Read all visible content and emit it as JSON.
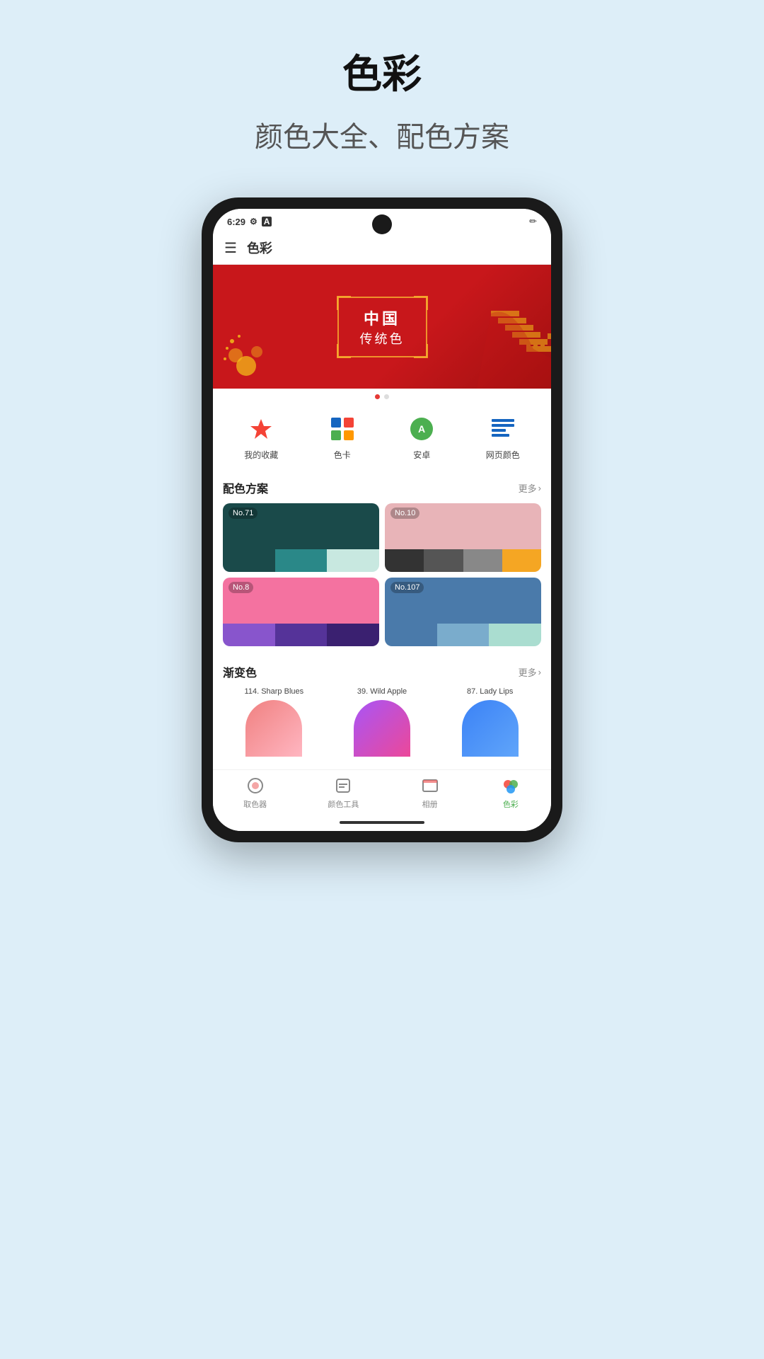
{
  "page": {
    "title": "色彩",
    "subtitle": "颜色大全、配色方案"
  },
  "status_bar": {
    "time": "6:29",
    "icons": [
      "settings-icon",
      "a-icon",
      "signal-icon"
    ]
  },
  "app_bar": {
    "menu_icon": "☰",
    "title": "色彩"
  },
  "banner": {
    "line1": "中国",
    "line2": "传统色"
  },
  "quick_menu": [
    {
      "icon": "⭐",
      "label": "我的收藏",
      "color": "#f44336"
    },
    {
      "icon": "🎨",
      "label": "色卡",
      "color": "#2196F3"
    },
    {
      "icon": "🤖",
      "label": "安卓",
      "color": "#4CAF50"
    },
    {
      "icon": "🌐",
      "label": "网页颜色",
      "color": "#1565C0"
    }
  ],
  "palette_section": {
    "title": "配色方案",
    "more_label": "更多",
    "cards": [
      {
        "id": "No.71",
        "top_color": "#1a4a4a",
        "swatches": [
          "#1a4a4a",
          "#2a7a7a",
          "#a8d8d8"
        ]
      },
      {
        "id": "No.10",
        "top_color": "#e8b4b8",
        "swatches": [
          "#333",
          "#666",
          "#999",
          "#f5a623"
        ]
      },
      {
        "id": "No.8",
        "top_color": "#f472a0",
        "swatches": [
          "#6b3fa0",
          "#4a2d7a",
          "#3a2060"
        ]
      },
      {
        "id": "No.107",
        "top_color": "#4a7aaa",
        "swatches": [
          "#4a7aaa",
          "#7aaccc",
          "#aaddd0"
        ]
      }
    ]
  },
  "gradient_section": {
    "title": "渐变色",
    "more_label": "更多",
    "items": [
      {
        "id": "114",
        "name": "114. Sharp Blues",
        "color_start": "#f08080",
        "color_end": "#ffb6c1",
        "gradient": "linear-gradient(135deg, #f08080, #ffb6c1)"
      },
      {
        "id": "39",
        "name": "39. Wild Apple",
        "color_start": "#a855f7",
        "color_end": "#ec4899",
        "gradient": "linear-gradient(135deg, #a855f7, #ec4899)"
      },
      {
        "id": "87",
        "name": "87. Lady Lips",
        "color_start": "#3b82f6",
        "color_end": "#60a5fa",
        "gradient": "linear-gradient(135deg, #3b82f6, #60a5fa)"
      }
    ]
  },
  "bottom_nav": [
    {
      "icon": "🎨",
      "label": "取色器",
      "active": false
    },
    {
      "icon": "🧰",
      "label": "颜色工具",
      "active": false
    },
    {
      "icon": "📷",
      "label": "相册",
      "active": false
    },
    {
      "icon": "🌈",
      "label": "色彩",
      "active": true
    }
  ]
}
